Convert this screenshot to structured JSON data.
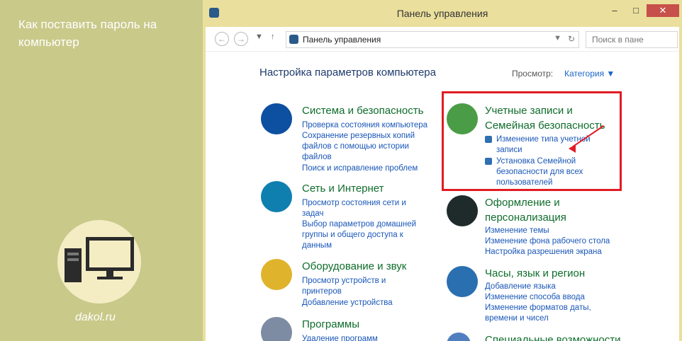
{
  "promo": {
    "title": "Как поставить пароль на компьютер",
    "site": "dakol.ru"
  },
  "window": {
    "title": "Панель управления",
    "controls": {
      "minimize": "–",
      "maximize": "□",
      "close": "✕"
    }
  },
  "address": {
    "back": "←",
    "forward": "→",
    "dropdown": "▼",
    "up": "↑",
    "breadcrumb_sep": "›",
    "path": "Панель управления",
    "path_arrow": "›",
    "path_dropdown": "▼",
    "refresh": "↻",
    "search_placeholder": "Поиск в пане"
  },
  "content": {
    "heading": "Настройка параметров компьютера",
    "view_label": "Просмотр:",
    "view_value": "Категория ▼"
  },
  "categories": [
    {
      "title": "Система и безопасность",
      "links": [
        "Проверка состояния компьютера",
        "Сохранение резервных копий",
        "файлов с помощью истории",
        "файлов",
        "Поиск и исправление проблем"
      ]
    },
    {
      "title": "Сеть и Интернет",
      "links": [
        "Просмотр состояния сети и",
        "задач",
        "Выбор параметров домашней",
        "группы и общего доступа к",
        "данным"
      ]
    },
    {
      "title": "Оборудование и звук",
      "links": [
        "Просмотр устройств и",
        "принтеров",
        "Добавление устройства"
      ]
    },
    {
      "title": "Программы",
      "links": [
        "Удаление программ"
      ]
    },
    {
      "title_lines": [
        "Учетные записи и",
        "Семейная безопасность"
      ],
      "links": [
        "Изменение типа учетной",
        "записи",
        "Установка Семейной",
        "безопасности для всех",
        "пользователей"
      ]
    },
    {
      "title_lines": [
        "Оформление и",
        "персонализация"
      ],
      "links": [
        "Изменение темы",
        "Изменение фона рабочего стола",
        "Настройка разрешения экрана"
      ]
    },
    {
      "title": "Часы, язык и регион",
      "links": [
        "Добавление языка",
        "Изменение способа ввода",
        "Изменение форматов даты,",
        "времени и чисел"
      ]
    },
    {
      "title": "Специальные возможности"
    }
  ],
  "colors": {
    "promo_bg": "#c9c98a",
    "frame": "#eadf9c",
    "category_title": "#0f6d2c",
    "link": "#1a57b8",
    "highlight": "#e21b23"
  }
}
